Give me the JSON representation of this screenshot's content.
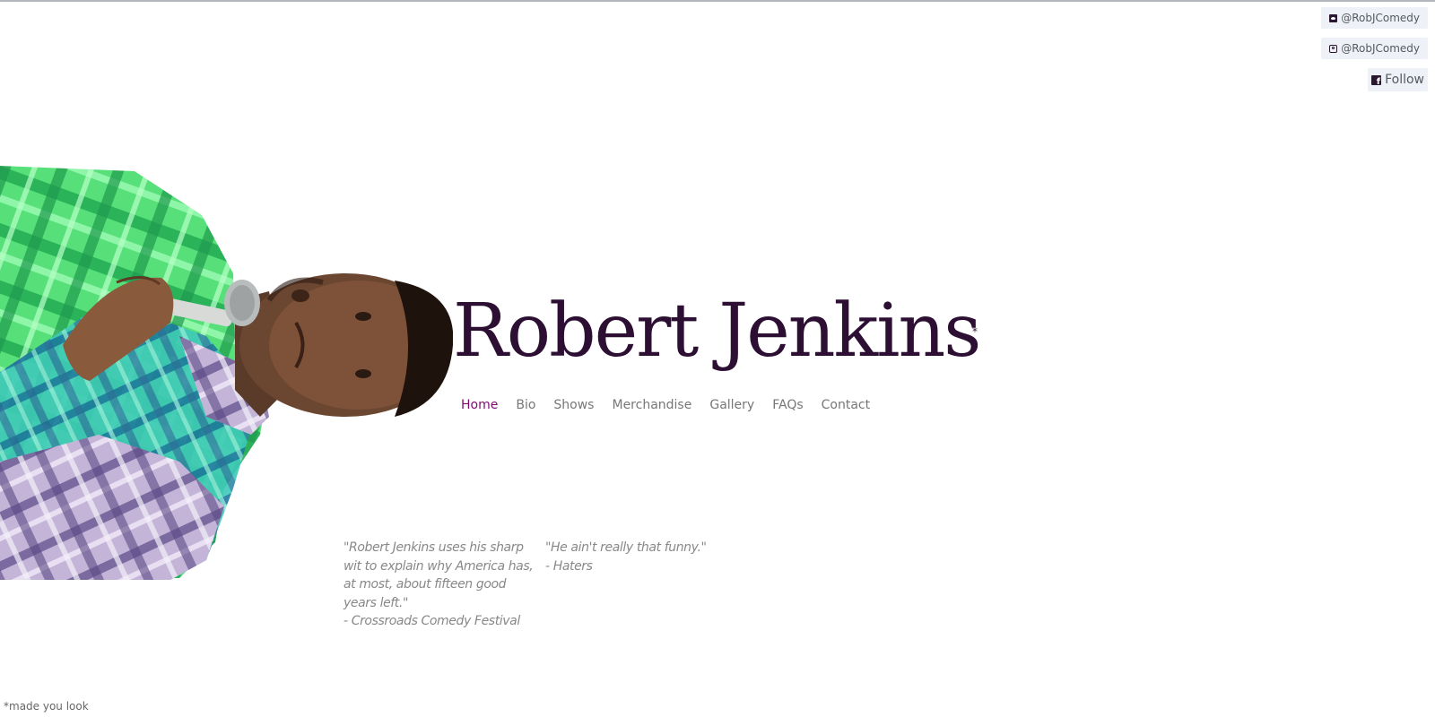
{
  "social": {
    "twitter_label": "@RobJComedy",
    "instagram_label": "@RobJComedy",
    "facebook_label": "Follow"
  },
  "hero": {
    "name": "Robert Jenkins",
    "asterisk": "*"
  },
  "nav": {
    "items": [
      "Home",
      "Bio",
      "Shows",
      "Merchandise",
      "Gallery",
      "FAQs",
      "Contact"
    ],
    "active": "Home"
  },
  "quotes": [
    {
      "text": "\"Robert Jenkins uses his sharp wit to explain why America has, at most, about fifteen good years left.\"",
      "source": "- Crossroads Comedy Festival"
    },
    {
      "text": "\"He ain't really that funny.\"",
      "source": "- Haters"
    }
  ],
  "footnote": "*made you look",
  "colors": {
    "heading": "#2c0f33",
    "nav_active": "#7a0f70",
    "nav": "#777777",
    "social_bg": "#eef2f8"
  },
  "icons": [
    "twitter-icon",
    "instagram-icon",
    "facebook-icon"
  ]
}
